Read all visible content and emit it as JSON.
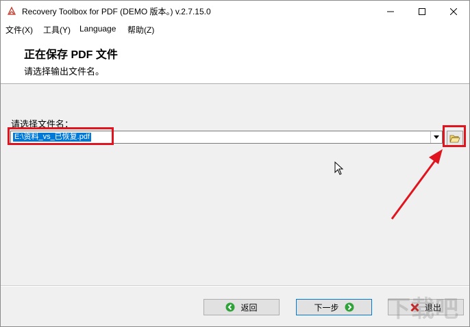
{
  "window": {
    "title": "Recovery Toolbox for PDF (DEMO 版本。) v.2.7.15.0",
    "icon": "pdf-app-icon",
    "controls": [
      "minimize-icon",
      "maximize-icon",
      "close-icon"
    ]
  },
  "menu": {
    "items": [
      {
        "label": "文件(X)"
      },
      {
        "label": "工具(Y)"
      },
      {
        "label": "Language"
      },
      {
        "label": "帮助(Z)"
      }
    ]
  },
  "header": {
    "title": "正在保存 PDF 文件",
    "subtitle": "请选择输出文件名。"
  },
  "form": {
    "file_label": "请选择文件名：",
    "file_value": "E:\\资料_vs_已恢复.pdf",
    "dropdown_icon": "chevron-down-icon",
    "browse_icon": "open-folder-icon"
  },
  "buttons": {
    "back": {
      "label": "返回",
      "icon": "back-arrow-icon"
    },
    "next": {
      "label": "下一步",
      "icon": "next-arrow-icon"
    },
    "exit": {
      "label": "退出",
      "icon": "exit-x-icon"
    }
  },
  "watermark": {
    "text": "下载吧"
  },
  "colors": {
    "highlight": "#e0141e",
    "selection": "#0078d7",
    "nav_green": "#2fa33a",
    "exit_red": "#d11a1a"
  }
}
